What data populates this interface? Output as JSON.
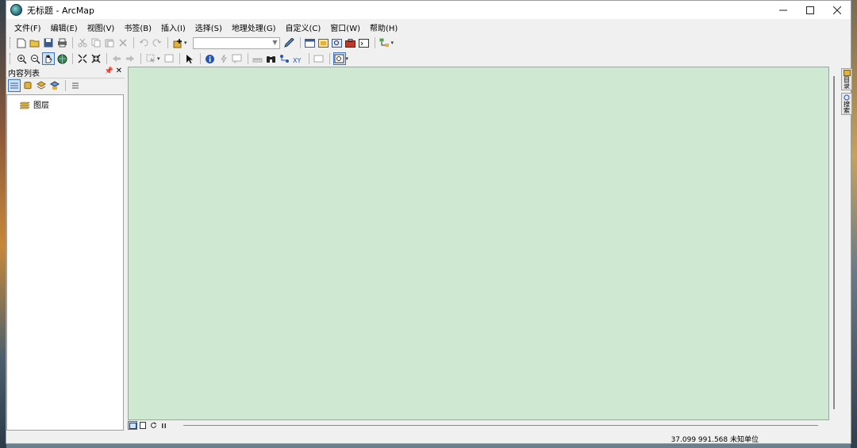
{
  "window": {
    "title": "无标题 - ArcMap"
  },
  "menu": {
    "items": [
      "文件(F)",
      "编辑(E)",
      "视图(V)",
      "书签(B)",
      "插入(I)",
      "选择(S)",
      "地理处理(G)",
      "自定义(C)",
      "窗口(W)",
      "帮助(H)"
    ]
  },
  "toolbar1": {
    "scale_value": ""
  },
  "toc": {
    "title": "内容列表",
    "layers_label": "图层"
  },
  "dock": {
    "tab1": "目录",
    "tab2": "搜索"
  },
  "status": {
    "coords": "37.099  991.568 未知单位"
  }
}
